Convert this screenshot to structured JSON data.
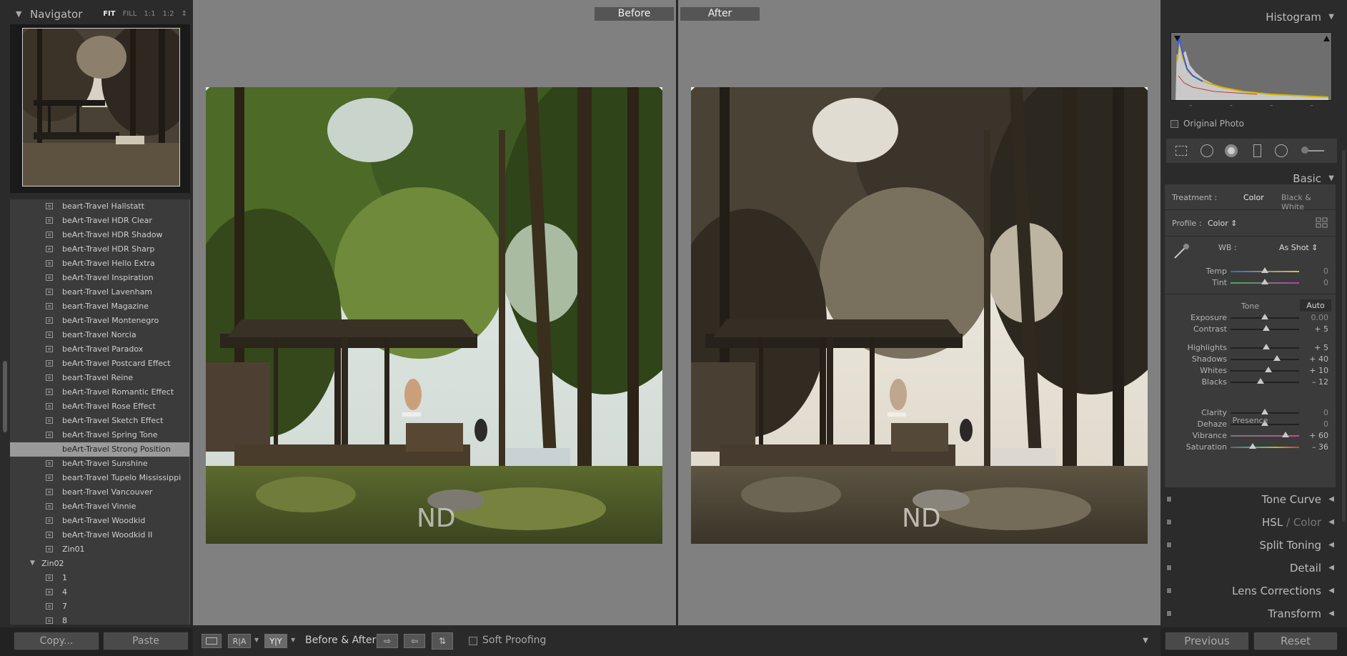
{
  "navigator": {
    "title": "Navigator",
    "zoom_fit": "FIT",
    "zoom_fill": "FILL",
    "zoom_1_1": "1:1",
    "zoom_custom": "1:2"
  },
  "presets": [
    {
      "label": "beart-Travel Hallstatt"
    },
    {
      "label": "beArt-Travel HDR Clear"
    },
    {
      "label": "beArt-Travel HDR Shadow"
    },
    {
      "label": "beArt-Travel HDR Sharp"
    },
    {
      "label": "beArt-Travel Hello Extra"
    },
    {
      "label": "beArt-Travel Inspiration"
    },
    {
      "label": "beart-Travel Lavenham"
    },
    {
      "label": "beart-Travel Magazine"
    },
    {
      "label": "beArt-Travel Montenegro"
    },
    {
      "label": "beart-Travel Norcia"
    },
    {
      "label": "beArt-Travel Paradox"
    },
    {
      "label": "beArt-Travel Postcard Effect"
    },
    {
      "label": "beart-Travel Reine"
    },
    {
      "label": "beArt-Travel Romantic Effect"
    },
    {
      "label": "beArt-Travel Rose Effect"
    },
    {
      "label": "beArt-Travel Sketch Effect"
    },
    {
      "label": "beArt-Travel Spring Tone"
    },
    {
      "label": "beArt-Travel Strong Position"
    },
    {
      "label": "beArt-Travel Sunshine"
    },
    {
      "label": "beart-Travel Tupelo Mississippi"
    },
    {
      "label": "beart-Travel Vancouver"
    },
    {
      "label": "beArt-Travel Vinnie"
    },
    {
      "label": "beArt-Travel Woodkid"
    },
    {
      "label": "beArt-Travel Woodkid II"
    },
    {
      "label": "Zin01"
    }
  ],
  "selected_preset": "beArt-Travel Strong Position",
  "folder": {
    "label": "Zin02",
    "items": [
      "1",
      "4",
      "7",
      "8"
    ]
  },
  "left_buttons": {
    "copy": "Copy...",
    "paste": "Paste"
  },
  "view": {
    "before_label": "Before",
    "after_label": "After",
    "watermark": "ND"
  },
  "toolbar": {
    "view_ra": "R|A",
    "view_yy": "Y|Y",
    "before_after_label": "Before & After :",
    "soft_proofing": "Soft Proofing"
  },
  "histogram": {
    "title": "Histogram",
    "original_photo": "Original Photo",
    "dash": "–"
  },
  "basic": {
    "title": "Basic",
    "treatment_label": "Treatment :",
    "treatment_color": "Color",
    "treatment_bw": "Black & White",
    "profile_label": "Profile :",
    "profile_value": "Color",
    "wb_label": "WB :",
    "wb_value": "As Shot",
    "tone_label": "Tone",
    "auto_label": "Auto",
    "presence_label": "Presence",
    "sliders": {
      "temp": {
        "label": "Temp",
        "value": "0",
        "pos": 0.5
      },
      "tint": {
        "label": "Tint",
        "value": "0",
        "pos": 0.5
      },
      "exposure": {
        "label": "Exposure",
        "value": "0.00",
        "pos": 0.5
      },
      "contrast": {
        "label": "Contrast",
        "value": "+ 5",
        "pos": 0.52
      },
      "highlights": {
        "label": "Highlights",
        "value": "+ 5",
        "pos": 0.52
      },
      "shadows": {
        "label": "Shadows",
        "value": "+ 40",
        "pos": 0.68
      },
      "whites": {
        "label": "Whites",
        "value": "+ 10",
        "pos": 0.55
      },
      "blacks": {
        "label": "Blacks",
        "value": "– 12",
        "pos": 0.44
      },
      "clarity": {
        "label": "Clarity",
        "value": "0",
        "pos": 0.5
      },
      "dehaze": {
        "label": "Dehaze",
        "value": "0",
        "pos": 0.5
      },
      "vibrance": {
        "label": "Vibrance",
        "value": "+ 60",
        "pos": 0.8
      },
      "saturation": {
        "label": "Saturation",
        "value": "– 36",
        "pos": 0.32
      }
    }
  },
  "panels": {
    "tone_curve": "Tone Curve",
    "hsl": "HSL",
    "hsl_sep": "/",
    "color": "Color",
    "split_toning": "Split Toning",
    "detail": "Detail",
    "lens_corrections": "Lens Corrections",
    "transform": "Transform"
  },
  "right_buttons": {
    "previous": "Previous",
    "reset": "Reset"
  },
  "colors": {
    "panel": "#2b2b2b",
    "list": "#3b3b3b",
    "canvas": "#808080",
    "selected": "#9a9a9a"
  }
}
